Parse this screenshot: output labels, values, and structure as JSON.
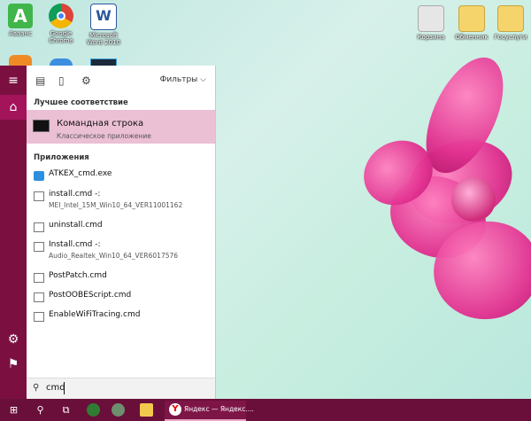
{
  "desktop": {
    "icons": [
      {
        "label": "Аваанс"
      },
      {
        "label": "Google Chrome"
      },
      {
        "label": "Microsoft Word 2010"
      },
      {
        "label": "Корзина"
      },
      {
        "label": "Обменник"
      },
      {
        "label": "Госуслуги"
      }
    ]
  },
  "start": {
    "filters_label": "Фильтры",
    "best_match_label": "Лучшее соответствие",
    "best_match": {
      "title": "Командная строка",
      "subtitle": "Классическое приложение"
    },
    "apps_label": "Приложения",
    "apps": [
      {
        "name_bold": "ATKEX_cmd.exe",
        "name_rest": "",
        "sub": ""
      },
      {
        "name_bold": "install.cmd",
        "name_rest": " -:",
        "sub": "MEI_Intel_15M_Win10_64_VER11001162"
      },
      {
        "name_bold": "uninstall.cmd",
        "name_rest": "",
        "sub": ""
      },
      {
        "name_bold": "Install.cmd",
        "name_rest": " -:",
        "sub": "Audio_Realtek_Win10_64_VER6017576"
      },
      {
        "name_bold": "PostPatch.cmd",
        "name_rest": "",
        "sub": ""
      },
      {
        "name_bold": "PostOOBEScript.cmd",
        "name_rest": "",
        "sub": ""
      },
      {
        "name_bold": "EnableWiFiTracing.cmd",
        "name_rest": "",
        "sub": ""
      }
    ],
    "search_value": "cmd"
  },
  "taskbar": {
    "active_app_label": "Яндекс — Яндекс...."
  },
  "colors": {
    "accent": "#7b1040",
    "best_match_bg": "#ebbfd4"
  }
}
